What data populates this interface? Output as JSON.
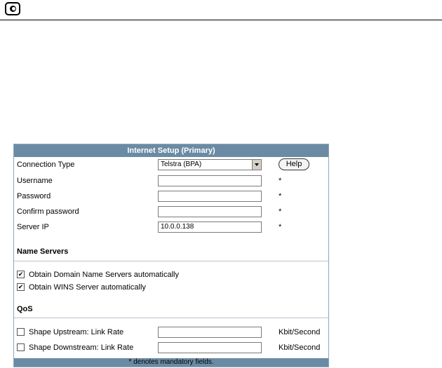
{
  "panel": {
    "title": "Internet Setup (Primary)",
    "connection_type_label": "Connection Type",
    "connection_type_value": "Telstra (BPA)",
    "help_label": "Help",
    "username_label": "Username",
    "password_label": "Password",
    "confirm_label": "Confirm password",
    "server_ip_label": "Server IP",
    "server_ip_value": "10.0.0.138",
    "required_mark": "*",
    "name_servers_title": "Name Servers",
    "obtain_dns_label": "Obtain Domain Name Servers automatically",
    "obtain_dns_checked": true,
    "obtain_wins_label": "Obtain WINS Server automatically",
    "obtain_wins_checked": true,
    "qos_title": "QoS",
    "shape_up_label": "Shape Upstream: Link Rate",
    "shape_down_label": "Shape Downstream: Link Rate",
    "unit_label": "Kbit/Second",
    "footer_note": "* denotes mandatory fields."
  }
}
